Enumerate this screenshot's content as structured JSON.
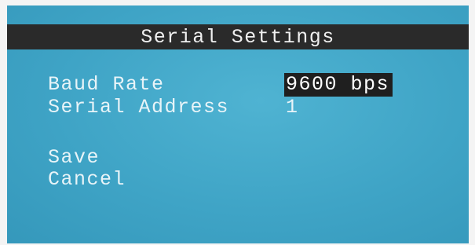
{
  "title": "Serial Settings",
  "settings": [
    {
      "label": "Baud Rate",
      "value": "9600 bps"
    },
    {
      "label": "Serial Address",
      "value": "1"
    }
  ],
  "actions": {
    "save_label": "Save",
    "cancel_label": "Cancel"
  },
  "colors": {
    "screen_background": "#3fa4c6",
    "title_bar_background": "#2a2a2a",
    "text": "#e8f4f8",
    "selection_background": "#1f1f1f"
  }
}
